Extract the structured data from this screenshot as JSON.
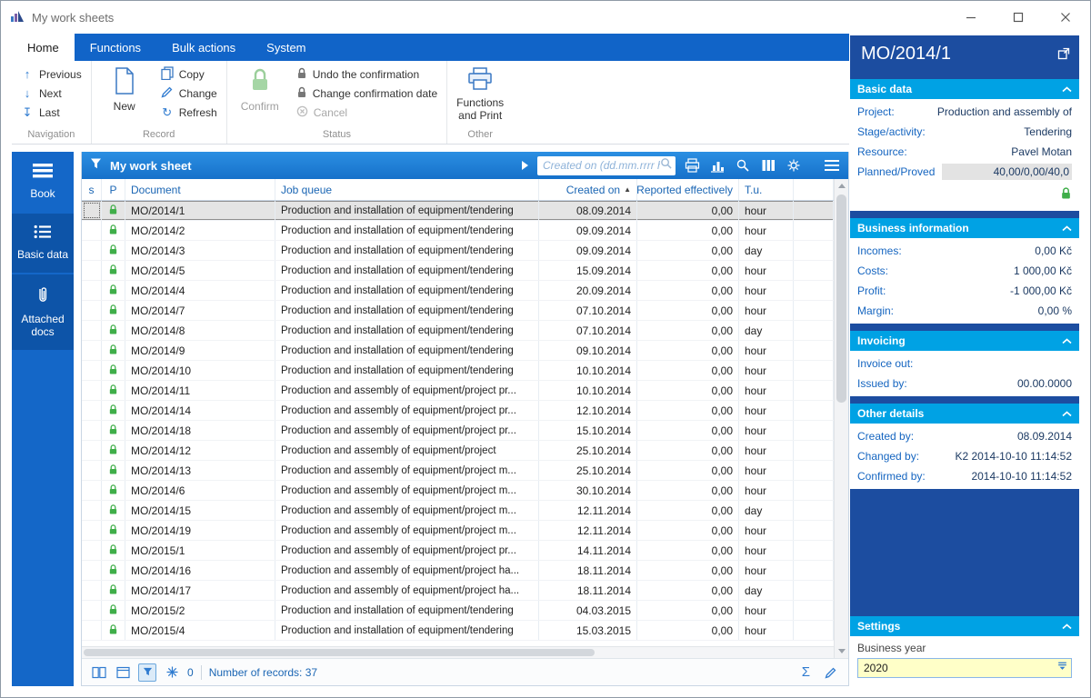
{
  "window": {
    "title": "My work sheets"
  },
  "ribbon": {
    "tabs": [
      {
        "label": "Home"
      },
      {
        "label": "Functions"
      },
      {
        "label": "Bulk actions"
      },
      {
        "label": "System"
      }
    ],
    "navigation": {
      "label": "Navigation",
      "items": [
        "Previous",
        "Next",
        "Last"
      ]
    },
    "record": {
      "label": "Record",
      "big": "New",
      "items": [
        "Copy",
        "Change",
        "Refresh"
      ]
    },
    "status": {
      "label": "Status",
      "big": "Confirm",
      "items": [
        "Undo the confirmation",
        "Change confirmation date",
        "Cancel"
      ]
    },
    "other": {
      "label": "Other",
      "big": "Functions and Print"
    }
  },
  "sidebar": {
    "items": [
      {
        "label": "Book"
      },
      {
        "label": "Basic data"
      },
      {
        "label": "Attached docs"
      }
    ]
  },
  "table": {
    "title": "My work sheet",
    "search_placeholder": "Created on (dd.mm.rrrr hh",
    "columns": [
      "s",
      "P",
      "Document",
      "Job queue",
      "Created on",
      "Reported effectively",
      "T.u."
    ],
    "rows": [
      {
        "doc": "MO/2014/1",
        "queue": "Production and installation of equipment/tendering",
        "created": "08.09.2014",
        "reported": "0,00",
        "tu": "hour",
        "cls": "selected"
      },
      {
        "doc": "MO/2014/2",
        "queue": "Production and installation of equipment/tendering",
        "created": "09.09.2014",
        "reported": "0,00",
        "tu": "hour"
      },
      {
        "doc": "MO/2014/3",
        "queue": "Production and installation of equipment/tendering",
        "created": "09.09.2014",
        "reported": "0,00",
        "tu": "day"
      },
      {
        "doc": "MO/2014/5",
        "queue": "Production and installation of equipment/tendering",
        "created": "15.09.2014",
        "reported": "0,00",
        "tu": "hour"
      },
      {
        "doc": "MO/2014/4",
        "queue": "Production and installation of equipment/tendering",
        "created": "20.09.2014",
        "reported": "0,00",
        "tu": "hour"
      },
      {
        "doc": "MO/2014/7",
        "queue": "Production and installation of equipment/tendering",
        "created": "07.10.2014",
        "reported": "0,00",
        "tu": "hour"
      },
      {
        "doc": "MO/2014/8",
        "queue": "Production and installation of equipment/tendering",
        "created": "07.10.2014",
        "reported": "0,00",
        "tu": "day"
      },
      {
        "doc": "MO/2014/9",
        "queue": "Production and installation of equipment/tendering",
        "created": "09.10.2014",
        "reported": "0,00",
        "tu": "hour"
      },
      {
        "doc": "MO/2014/10",
        "queue": "Production and installation of equipment/tendering",
        "created": "10.10.2014",
        "reported": "0,00",
        "tu": "hour"
      },
      {
        "doc": "MO/2014/11",
        "queue": "Production and assembly of equipment/project pr...",
        "created": "10.10.2014",
        "reported": "0,00",
        "tu": "hour"
      },
      {
        "doc": "MO/2014/14",
        "queue": "Production and assembly of equipment/project pr...",
        "created": "12.10.2014",
        "reported": "0,00",
        "tu": "hour"
      },
      {
        "doc": "MO/2014/18",
        "queue": "Production and assembly of equipment/project pr...",
        "created": "15.10.2014",
        "reported": "0,00",
        "tu": "hour"
      },
      {
        "doc": "MO/2014/12",
        "queue": "Production and assembly of equipment/project",
        "created": "25.10.2014",
        "reported": "0,00",
        "tu": "hour"
      },
      {
        "doc": "MO/2014/13",
        "queue": "Production and assembly of equipment/project m...",
        "created": "25.10.2014",
        "reported": "0,00",
        "tu": "hour"
      },
      {
        "doc": "MO/2014/6",
        "queue": "Production and assembly of equipment/project m...",
        "created": "30.10.2014",
        "reported": "0,00",
        "tu": "hour"
      },
      {
        "doc": "MO/2014/15",
        "queue": "Production and assembly of equipment/project m...",
        "created": "12.11.2014",
        "reported": "0,00",
        "tu": "day"
      },
      {
        "doc": "MO/2014/19",
        "queue": "Production and assembly of equipment/project m...",
        "created": "12.11.2014",
        "reported": "0,00",
        "tu": "hour"
      },
      {
        "doc": "MO/2015/1",
        "queue": "Production and assembly of equipment/project pr...",
        "created": "14.11.2014",
        "reported": "0,00",
        "tu": "hour"
      },
      {
        "doc": "MO/2014/16",
        "queue": "Production and assembly of equipment/project ha...",
        "created": "18.11.2014",
        "reported": "0,00",
        "tu": "hour"
      },
      {
        "doc": "MO/2014/17",
        "queue": "Production and assembly of equipment/project ha...",
        "created": "18.11.2014",
        "reported": "0,00",
        "tu": "day"
      },
      {
        "doc": "MO/2015/2",
        "queue": "Production and installation of equipment/tendering",
        "created": "04.03.2015",
        "reported": "0,00",
        "tu": "hour"
      },
      {
        "doc": "MO/2015/4",
        "queue": "Production and installation of equipment/tendering",
        "created": "15.03.2015",
        "reported": "0,00",
        "tu": "hour"
      }
    ],
    "footer": {
      "badge": "0",
      "records_label": "Number of records: 37"
    }
  },
  "panel": {
    "title": "MO/2014/1",
    "basic": {
      "header": "Basic data",
      "fields": [
        {
          "label": "Project:",
          "value": "Production and assembly of"
        },
        {
          "label": "Stage/activity:",
          "value": "Tendering"
        },
        {
          "label": "Resource:",
          "value": "Pavel Motan"
        },
        {
          "label": "Planned/Proved",
          "value": "40,00/0,00/40,0",
          "cls": "hl"
        }
      ]
    },
    "business": {
      "header": "Business information",
      "fields": [
        {
          "label": "Incomes:",
          "value": "0,00 Kč"
        },
        {
          "label": "Costs:",
          "value": "1 000,00 Kč"
        },
        {
          "label": "Profit:",
          "value": "-1 000,00 Kč"
        },
        {
          "label": "Margin:",
          "value": "0,00 %"
        }
      ]
    },
    "invoicing": {
      "header": "Invoicing",
      "fields": [
        {
          "label": "Invoice out:",
          "value": ""
        },
        {
          "label": "Issued by:",
          "value": "00.00.0000"
        }
      ]
    },
    "other": {
      "header": "Other details",
      "fields": [
        {
          "label": "Created by:",
          "value": "08.09.2014"
        },
        {
          "label": "Changed by:",
          "value": "K2 2014-10-10 11:14:52"
        },
        {
          "label": "Confirmed by:",
          "value": "2014-10-10 11:14:52"
        }
      ]
    },
    "settings": {
      "header": "Settings",
      "field_label": "Business year",
      "value": "2020"
    }
  }
}
